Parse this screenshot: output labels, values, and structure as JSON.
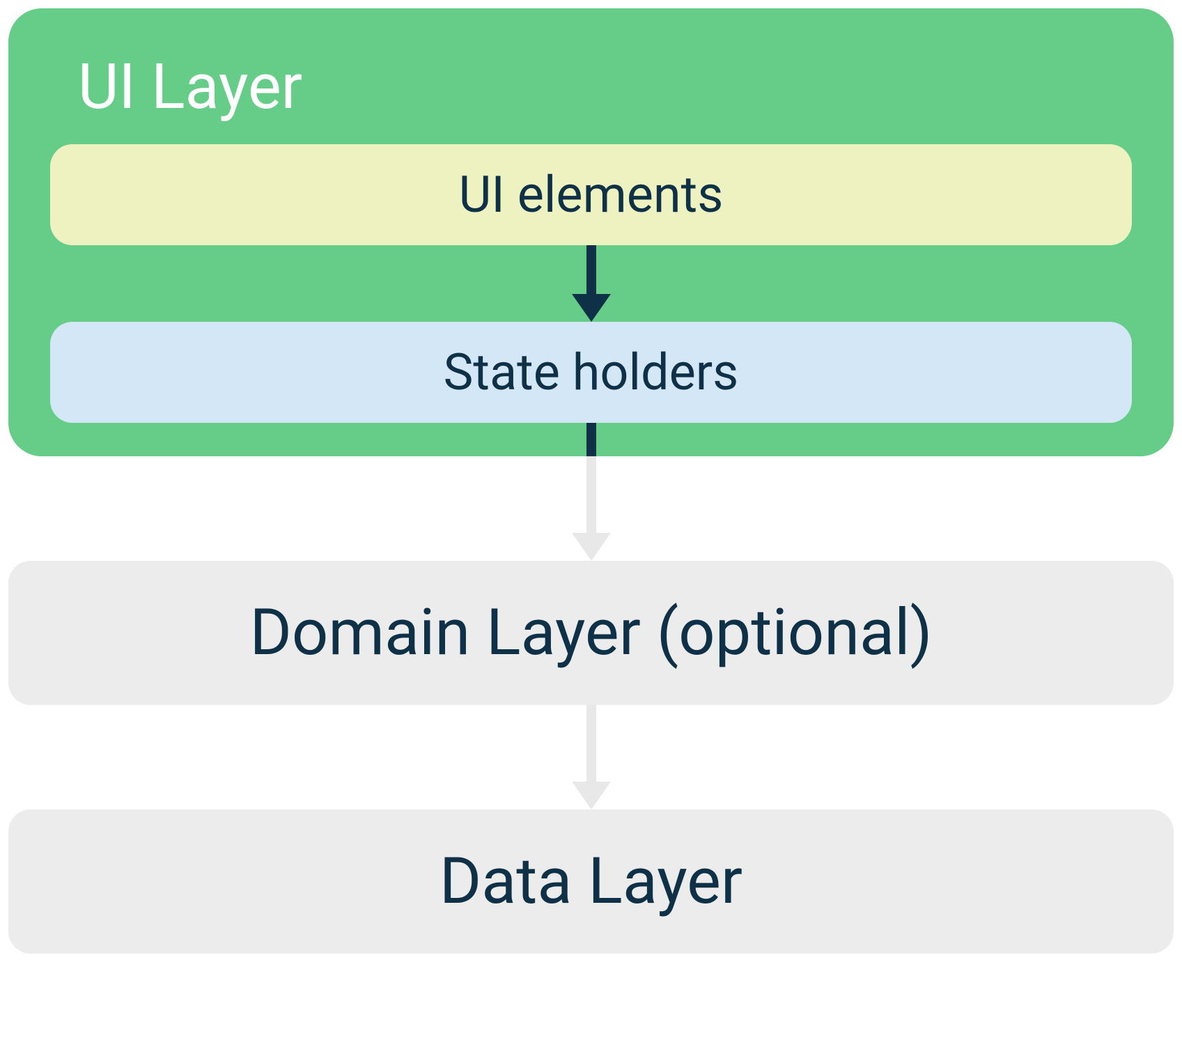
{
  "ui_layer": {
    "title": "UI Layer",
    "ui_elements_label": "UI elements",
    "state_holders_label": "State holders"
  },
  "domain_layer": {
    "label": "Domain Layer (optional)"
  },
  "data_layer": {
    "label": "Data Layer"
  },
  "colors": {
    "ui_layer_bg": "#65cd87",
    "ui_elements_bg": "#eef2c0",
    "state_holders_bg": "#d4e7f7",
    "layer_box_bg": "#ececec",
    "text_dark": "#0f3147",
    "text_light": "#ffffff",
    "arrow_dark": "#0f3147",
    "arrow_light": "#e8e8e8"
  }
}
